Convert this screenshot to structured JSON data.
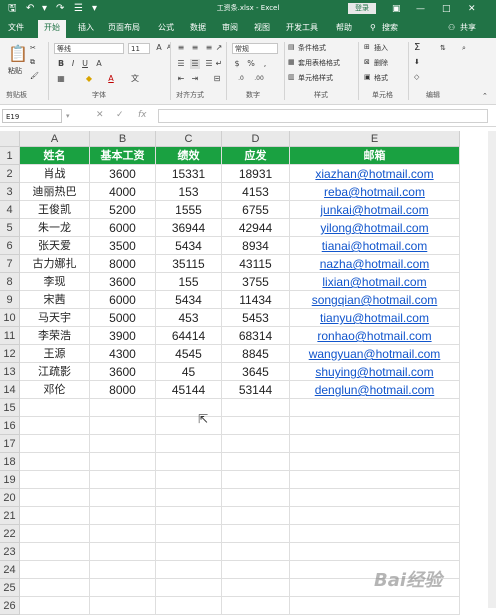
{
  "app": {
    "title": "工资条.xlsx - Excel",
    "login_label": "登录",
    "share_label": "共享",
    "search_label": "搜索"
  },
  "tabs": [
    "文件",
    "开始",
    "插入",
    "页面布局",
    "公式",
    "数据",
    "审阅",
    "视图",
    "开发工具",
    "帮助"
  ],
  "active_tab": 1,
  "ribbon": {
    "paste_label": "粘贴",
    "font_name": "等线",
    "font_size": "11",
    "number_format": "常规",
    "cond_format": "条件格式",
    "table_format": "套用表格格式",
    "cell_style": "单元格样式",
    "insert": "插入",
    "delete": "删除",
    "format": "格式",
    "groups": {
      "clipboard": "剪贴板",
      "font": "字体",
      "align": "对齐方式",
      "number": "数字",
      "style": "样式",
      "cells": "单元格",
      "edit": "编辑"
    }
  },
  "formula_bar": {
    "name_box": "E19",
    "cancel_icon": "✕",
    "enter_icon": "✓",
    "fx_label": "fx",
    "value": ""
  },
  "sheet": {
    "columns": [
      "A",
      "B",
      "C",
      "D",
      "E"
    ],
    "row_count": 26,
    "headers": [
      "姓名",
      "基本工资",
      "绩效",
      "应发",
      "邮箱"
    ],
    "rows": [
      [
        "肖战",
        "3600",
        "15331",
        "18931",
        "xiazhan@hotmail.com"
      ],
      [
        "迪丽热巴",
        "4000",
        "153",
        "4153",
        "reba@hotmail.com"
      ],
      [
        "王俊凯",
        "5200",
        "1555",
        "6755",
        "junkai@hotmail.com"
      ],
      [
        "朱一龙",
        "6000",
        "36944",
        "42944",
        "yilong@hotmail.com"
      ],
      [
        "张天爱",
        "3500",
        "5434",
        "8934",
        "tianai@hotmail.com"
      ],
      [
        "古力娜扎",
        "8000",
        "35115",
        "43115",
        "nazha@hotmail.com"
      ],
      [
        "李现",
        "3600",
        "155",
        "3755",
        "lixian@hotmail.com"
      ],
      [
        "宋茜",
        "6000",
        "5434",
        "11434",
        "songqian@hotmail.com"
      ],
      [
        "马天宇",
        "5000",
        "453",
        "5453",
        "tianyu@hotmail.com"
      ],
      [
        "李荣浩",
        "3900",
        "64414",
        "68314",
        "ronhao@hotmail.com"
      ],
      [
        "王源",
        "4300",
        "4545",
        "8845",
        "wangyuan@hotmail.com"
      ],
      [
        "江疏影",
        "3600",
        "45",
        "3645",
        "shuying@hotmail.com"
      ],
      [
        "邓伦",
        "8000",
        "45144",
        "53144",
        "denglun@hotmail.com"
      ]
    ]
  },
  "watermark": "Bai经验",
  "colors": {
    "title_bar": "#217346",
    "header_fill": "#1aa141",
    "link": "#1155cc"
  }
}
